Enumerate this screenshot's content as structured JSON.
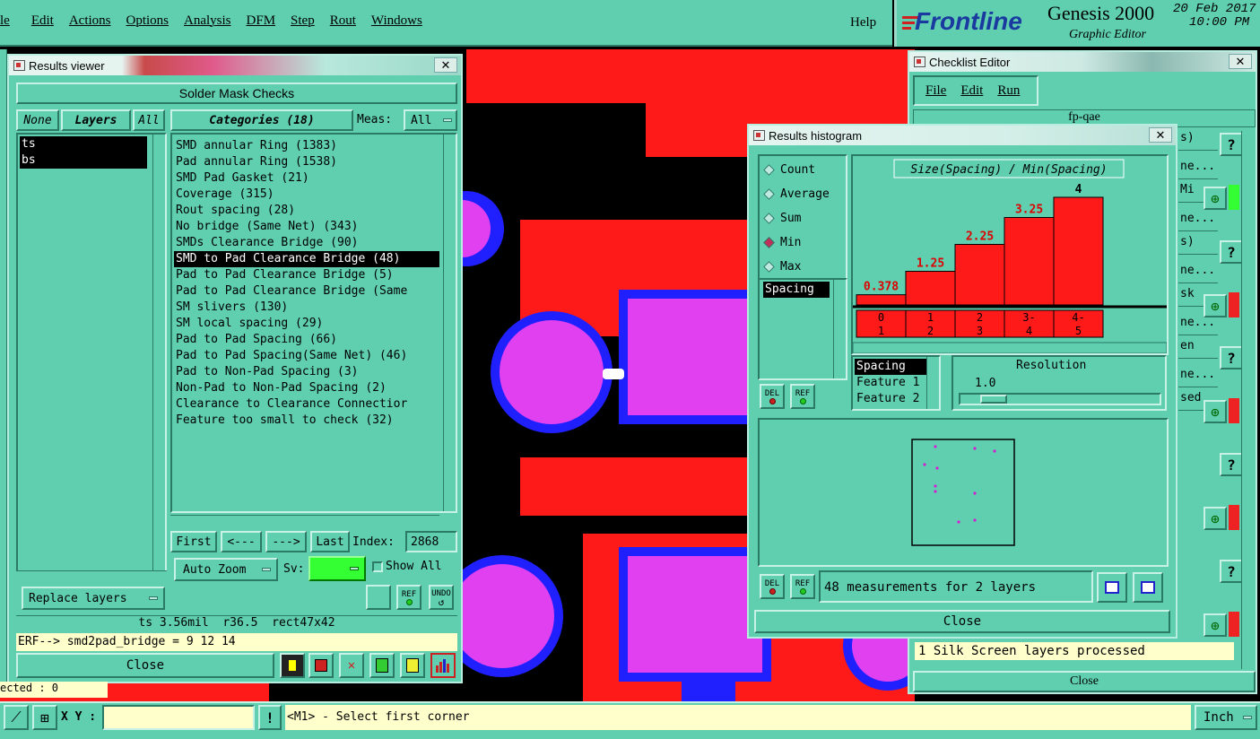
{
  "menu": {
    "items": [
      "le",
      "Edit",
      "Actions",
      "Options",
      "Analysis",
      "DFM",
      "Step",
      "Rout",
      "Windows"
    ],
    "help": "Help"
  },
  "brand": {
    "logo": "Frontline",
    "product": "Genesis 2000",
    "subtitle": "Graphic Editor",
    "date": "20 Feb 2017",
    "time": "10:00 PM"
  },
  "results_viewer": {
    "title": "Results viewer",
    "header": "Solder Mask Checks",
    "layer_buttons": {
      "none": "None",
      "layers": "Layers",
      "all": "All"
    },
    "layers": [
      "ts",
      "bs"
    ],
    "categories_label": "Categories (18)",
    "meas_label": "Meas:",
    "meas_value": "All",
    "categories": [
      "SMD annular Ring (1383)",
      "Pad annular Ring (1538)",
      "SMD Pad Gasket (21)",
      "Coverage (315)",
      "Rout spacing (28)",
      "No bridge (Same Net) (343)",
      "SMDs Clearance Bridge (90)",
      "SMD to Pad Clearance Bridge (48)",
      "Pad to Pad Clearance Bridge (5)",
      "Pad to Pad Clearance Bridge (Same",
      "SM slivers (130)",
      "SM local spacing (29)",
      "Pad to Pad Spacing (66)",
      "Pad to Pad Spacing(Same Net) (46)",
      "Pad to Non-Pad Spacing (3)",
      "Non-Pad to Non-Pad Spacing (2)",
      "Clearance to Clearance Connectior",
      "Feature too small to check (32)"
    ],
    "selected_category_index": 7,
    "nav": {
      "first": "First",
      "prev": "<---",
      "next": "--->",
      "last": "Last",
      "index_label": "Index:",
      "index_value": "2868"
    },
    "auto_zoom": "Auto Zoom",
    "sv_label": "Sv:",
    "show_all": "Show All",
    "replace_layers": "Replace layers",
    "ref": "REF",
    "undo": "UNDO",
    "info": "ts 3.56mil  r36.5  rect47x42",
    "erf": "ERF--> smd2pad_bridge = 9 12 14",
    "close": "Close"
  },
  "histogram": {
    "title": "Results histogram",
    "modes": [
      "Count",
      "Average",
      "Sum",
      "Min",
      "Max"
    ],
    "selected_mode": "Min",
    "list_items": [
      "Spacing"
    ],
    "chart_title": "Size(Spacing) / Min(Spacing)",
    "bars": [
      {
        "label": "0.378",
        "value": 0.378,
        "x_top": "0",
        "x_bottom": "1"
      },
      {
        "label": "1.25",
        "value": 1.25,
        "x_top": "1",
        "x_bottom": "2"
      },
      {
        "label": "2.25",
        "value": 2.25,
        "x_top": "2",
        "x_bottom": "3"
      },
      {
        "label": "3.25",
        "value": 3.25,
        "x_top": "3-",
        "x_bottom": "4"
      },
      {
        "label": "4",
        "value": 4,
        "x_top": "4-",
        "x_bottom": "5"
      }
    ],
    "fields": [
      "Spacing",
      "Feature 1",
      "Feature 2"
    ],
    "resolution_label": "Resolution",
    "resolution_value": "1.0",
    "del": "DEL",
    "ref": "REF",
    "measurements": "48 measurements for 2 layers",
    "close": "Close"
  },
  "checklist": {
    "title": "Checklist Editor",
    "menu": [
      "File",
      "Edit",
      "Run"
    ],
    "job": "fp-qae",
    "right_fragments": [
      "s)",
      "ne...",
      "Mi",
      "ne...",
      "s)",
      "ne...",
      "sk",
      "ne...",
      "en",
      "ne...",
      "sed"
    ],
    "status": "1 Silk Screen layers processed",
    "close": "Close"
  },
  "bottom": {
    "xy_label": "X Y :",
    "xy_value": "",
    "prompt": "<M1> - Select first corner",
    "units": "Inch",
    "left_fragment": "ected : 0"
  },
  "colors": {
    "panel": "#5fcfb0",
    "bar": "#ff1a1a",
    "pcb_copper": "#ff1a1a",
    "pcb_pad": "#e040f0",
    "pcb_outline": "#2020ff",
    "background": "#000000"
  }
}
